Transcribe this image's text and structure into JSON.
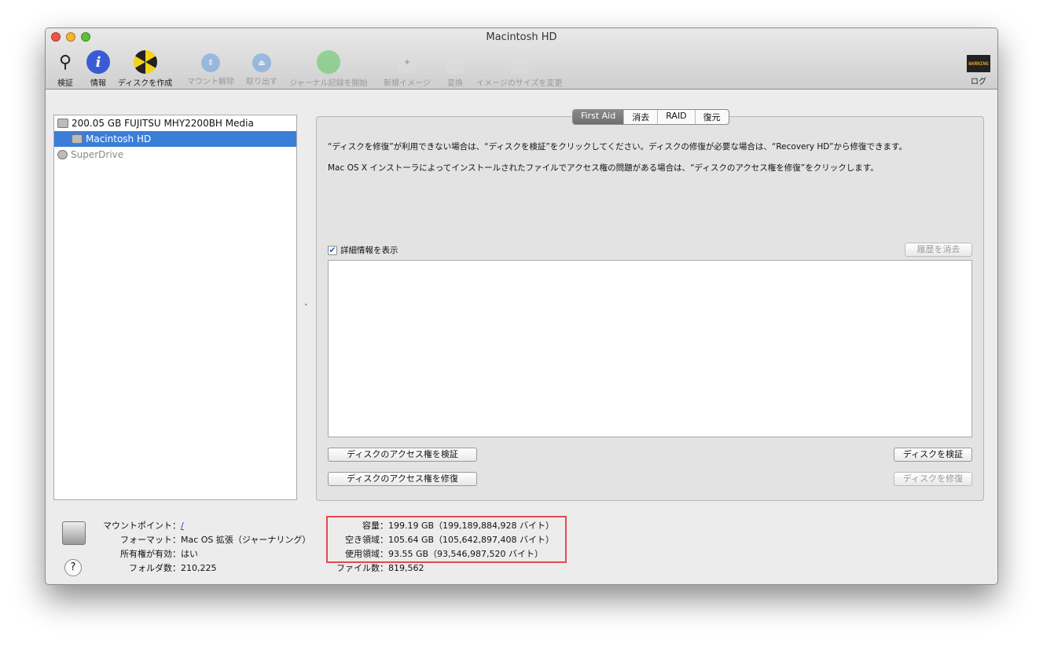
{
  "window": {
    "title": "Macintosh HD"
  },
  "toolbar": [
    {
      "label": "検証",
      "icon": "microscope-icon",
      "enabled": true
    },
    {
      "label": "情報",
      "icon": "info-icon",
      "enabled": true
    },
    {
      "label": "ディスクを作成",
      "icon": "burn-icon",
      "enabled": true
    },
    {
      "label": "マウント解除",
      "icon": "unmount-icon",
      "enabled": false
    },
    {
      "label": "取り出す",
      "icon": "eject-icon",
      "enabled": false
    },
    {
      "label": "ジャーナル記録を開始",
      "icon": "journal-icon",
      "enabled": false
    },
    {
      "label": "新規イメージ",
      "icon": "new-image-icon",
      "enabled": false
    },
    {
      "label": "変換",
      "icon": "convert-icon",
      "enabled": false
    },
    {
      "label": "イメージのサイズを変更",
      "icon": "resize-image-icon",
      "enabled": false
    },
    {
      "label": "ログ",
      "icon": "log-icon",
      "enabled": true
    }
  ],
  "log_icon_text": "WARNING",
  "sidebar": {
    "items": [
      "200.05 GB FUJITSU MHY2200BH Media",
      "Macintosh HD",
      "SuperDrive"
    ]
  },
  "tabs": [
    "First Aid",
    "消去",
    "RAID",
    "復元"
  ],
  "first_aid": {
    "text1": "“ディスクを修復”が利用できない場合は、“ディスクを検証”をクリックしてください。ディスクの修復が必要な場合は、“Recovery HD”から修復できます。",
    "text2": "Mac OS X インストーラによってインストールされたファイルでアクセス権の問題がある場合は、“ディスクのアクセス権を修復”をクリックします。",
    "show_details": "詳細情報を表示",
    "show_details_checked": true,
    "clear_history": "履歴を消去",
    "verify_permissions": "ディスクのアクセス権を検証",
    "repair_permissions": "ディスクのアクセス権を修復",
    "verify_disk": "ディスクを検証",
    "repair_disk": "ディスクを修復"
  },
  "info": {
    "mount_point_label": "マウントポイント：",
    "mount_point": "/",
    "format_label": "フォーマット：",
    "format": "Mac OS 拡張（ジャーナリング）",
    "owners_label": "所有権が有効：",
    "owners": "はい",
    "folders_label": "フォルダ数：",
    "folders": "210,225",
    "capacity_label": "容量：",
    "capacity": "199.19 GB（199,189,884,928 バイト）",
    "free_label": "空き領域：",
    "free": "105.64 GB（105,642,897,408 バイト）",
    "used_label": "使用領域：",
    "used": "93.55 GB（93,546,987,520 バイト）",
    "files_label": "ファイル数：",
    "files": "819,562"
  }
}
